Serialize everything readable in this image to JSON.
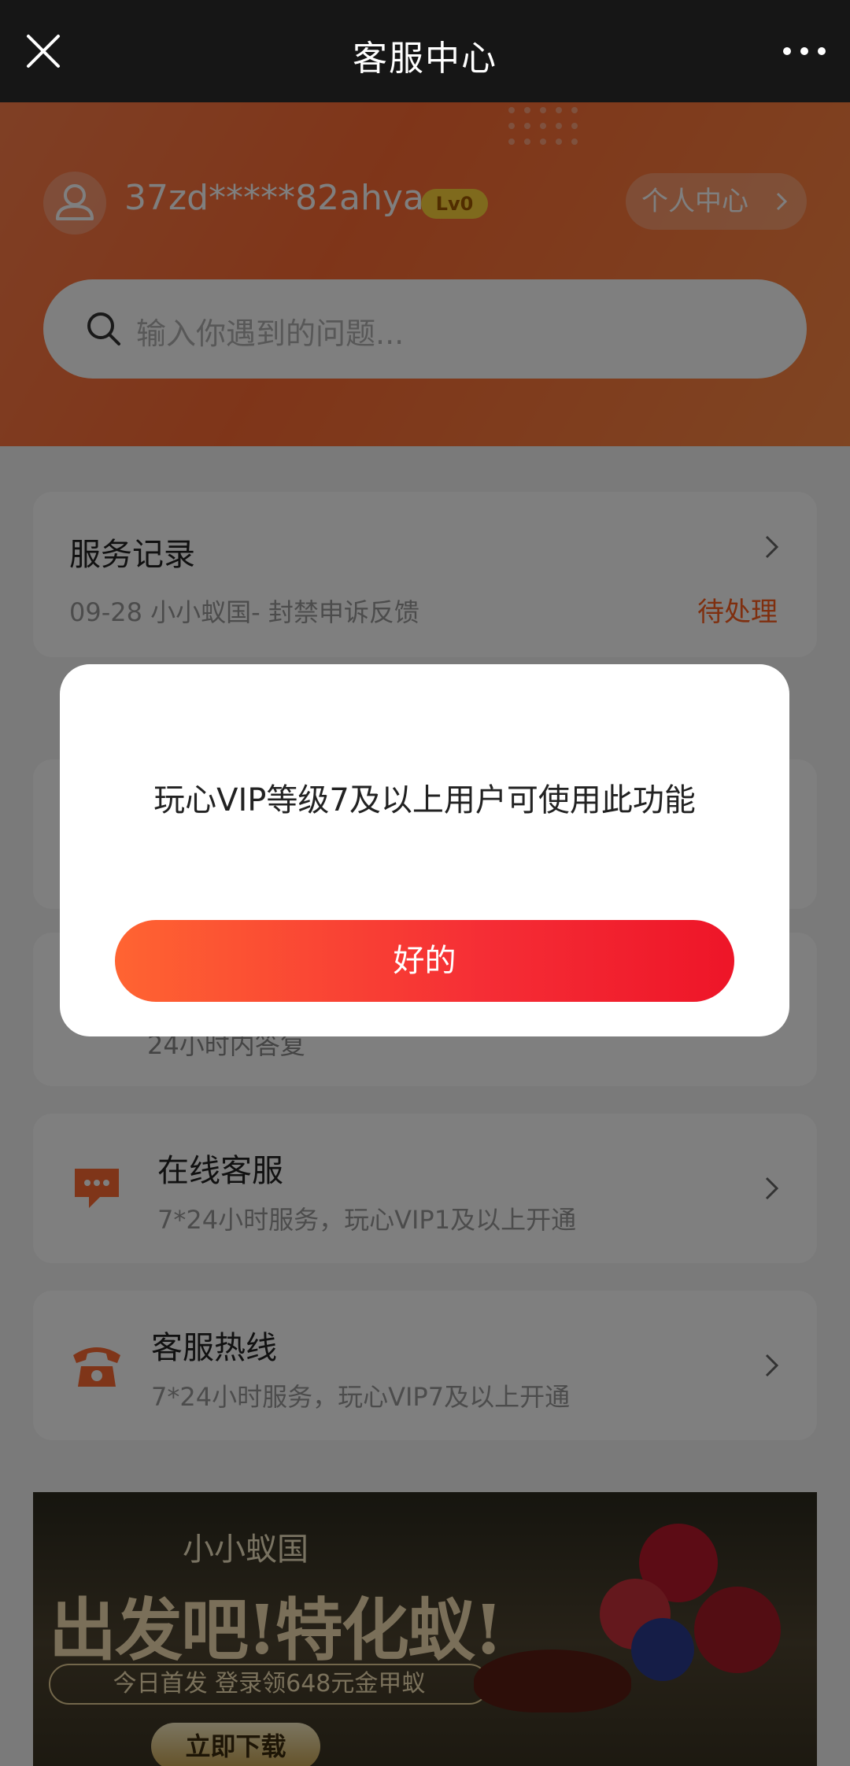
{
  "topbar": {
    "title": "客服中心"
  },
  "profile": {
    "username": "37zd*****82ahya",
    "level_badge": "Lv0",
    "personal_center": "个人中心"
  },
  "search": {
    "placeholder": "输入你遇到的问题..."
  },
  "service_record": {
    "title": "服务记录",
    "entry": "09-28 小小蚁国- 封禁申诉反馈",
    "status": "待处理"
  },
  "feedback_card": {
    "subtitle_partial": "24小时内答复"
  },
  "online_service": {
    "title": "在线客服",
    "subtitle": "7*24小时服务，玩心VIP1及以上开通"
  },
  "hotline": {
    "title": "客服热线",
    "subtitle": "7*24小时服务，玩心VIP7及以上开通"
  },
  "banner": {
    "logo": "小小蚁国",
    "slogan": "出发吧!特化蚁!",
    "promo": "今日首发 登录领648元金甲蚁",
    "download": "立即下载"
  },
  "dialog": {
    "message": "玩心VIP等级7及以上用户可使用此功能",
    "confirm": "好的"
  },
  "colors": {
    "accent_orange": "#ff6b33",
    "status_orange": "#ff5f1f",
    "button_red": "#f52d35",
    "level_yellow": "#ffd43b"
  },
  "icons": [
    "close-icon",
    "more-icon",
    "user-icon",
    "chevron-right-icon",
    "search-icon",
    "chat-icon",
    "phone-icon"
  ]
}
